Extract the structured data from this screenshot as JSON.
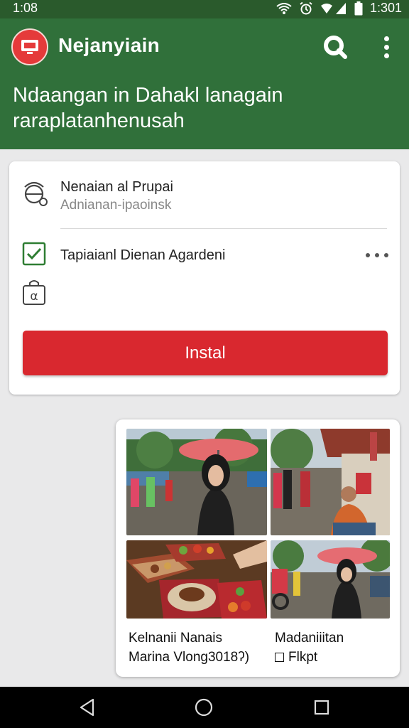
{
  "status_bar": {
    "time": "1:08",
    "battery_text": "1:301",
    "icons": [
      "wifi-icon",
      "alarm-icon",
      "signal-icon",
      "battery-icon"
    ]
  },
  "app_bar": {
    "title": "Nejanyiain",
    "headline": "Ndaangan in Dahakl lanagain raraplatanhenusah",
    "icons": [
      "app-logo-icon",
      "search-icon",
      "more-vert-icon"
    ],
    "colors": {
      "background": "#30703a",
      "status_bar": "#2a5a2c",
      "logo": "#e53a3a"
    }
  },
  "card": {
    "item1": {
      "title": "Nenaian al Prupai",
      "subtitle": "Adnianan-ipaoinsk",
      "icon": "sync-clock-icon"
    },
    "item2": {
      "title": "Tapiaianl Dienan Agardeni",
      "icon": "checkbox-checked-icon",
      "checked": true
    },
    "item3": {
      "icon": "lock-alpha-icon"
    },
    "install_label": "Instal",
    "install_color": "#d9282f"
  },
  "gallery": {
    "captions": [
      {
        "line1": "Kelnanii Nanais",
        "line2": "Marina Vlong3018ʔ)"
      },
      {
        "line1": "Madaniiitan",
        "line2": "Flkpt"
      }
    ]
  },
  "nav_bar": {
    "icons": [
      "back-icon",
      "home-icon",
      "recents-icon"
    ]
  }
}
